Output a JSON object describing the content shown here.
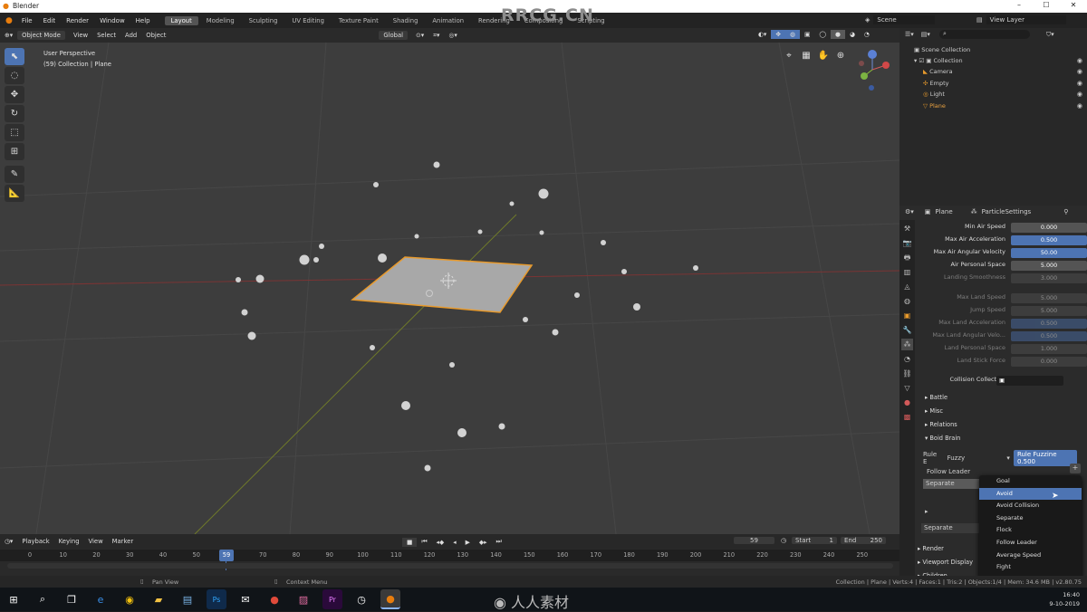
{
  "window": {
    "title": "Blender"
  },
  "menu": [
    "File",
    "Edit",
    "Render",
    "Window",
    "Help"
  ],
  "workspaces": [
    {
      "label": "Layout",
      "active": true
    },
    {
      "label": "Modeling",
      "active": false
    },
    {
      "label": "Sculpting",
      "active": false
    },
    {
      "label": "UV Editing",
      "active": false
    },
    {
      "label": "Texture Paint",
      "active": false
    },
    {
      "label": "Shading",
      "active": false
    },
    {
      "label": "Animation",
      "active": false
    },
    {
      "label": "Rendering",
      "active": false
    },
    {
      "label": "Compositing",
      "active": false
    },
    {
      "label": "Scripting",
      "active": false
    }
  ],
  "scene": {
    "label": "Scene",
    "view_layer": "View Layer"
  },
  "viewport_header": {
    "mode": "Object Mode",
    "menus": [
      "View",
      "Select",
      "Add",
      "Object"
    ],
    "orientation": "Global"
  },
  "viewport_info": {
    "line1": "User Perspective",
    "line2": "(59) Collection | Plane"
  },
  "watermark": "RRCG.CN",
  "outliner": {
    "scene_collection": "Scene Collection",
    "collection": "Collection",
    "items": [
      "Camera",
      "Empty",
      "Light",
      "Plane"
    ]
  },
  "properties": {
    "object": "Plane",
    "settings": "ParticleSettings",
    "rows": [
      {
        "label": "Min Air Speed",
        "value": "0.000",
        "blue": false,
        "dim": false
      },
      {
        "label": "Max Air Acceleration",
        "value": "0.500",
        "blue": true,
        "dim": false
      },
      {
        "label": "Max Air Angular Velocity",
        "value": "50.00",
        "blue": true,
        "dim": false
      },
      {
        "label": "Air Personal Space",
        "value": "5.000",
        "blue": false,
        "dim": false
      },
      {
        "label": "Landing Smoothness",
        "value": "3.000",
        "blue": false,
        "dim": true
      },
      {
        "label": "Max Land Speed",
        "value": "5.000",
        "blue": false,
        "dim": true
      },
      {
        "label": "Jump Speed",
        "value": "5.000",
        "blue": false,
        "dim": true
      },
      {
        "label": "Max Land Acceleration",
        "value": "0.500",
        "blue": true,
        "dim": true
      },
      {
        "label": "Max Land Angular Velo...",
        "value": "0.500",
        "blue": true,
        "dim": true
      },
      {
        "label": "Land Personal Space",
        "value": "1.000",
        "blue": false,
        "dim": true
      },
      {
        "label": "Land Stick Force",
        "value": "0.000",
        "blue": false,
        "dim": true
      }
    ],
    "collision_label": "Collision Collection",
    "panels": [
      "Battle",
      "Misc",
      "Relations",
      "Boid Brain"
    ],
    "rule_label": "Rule E",
    "rule_value": "Fuzzy",
    "rule_fuzziness": "Rule Fuzzine 0.500",
    "follow_leader": "Follow Leader",
    "separate_a": "Separate",
    "separate_b": "Separate",
    "lower_panels": [
      "Render",
      "Viewport Display",
      "Children"
    ]
  },
  "dropdown": {
    "options": [
      "Goal",
      "Avoid",
      "Avoid Collision",
      "Separate",
      "Flock",
      "Follow Leader",
      "Average Speed",
      "Fight"
    ],
    "highlighted": "Avoid"
  },
  "timeline": {
    "menus": [
      "Playback",
      "Keying",
      "View",
      "Marker"
    ],
    "current_frame": "59",
    "start_label": "Start",
    "start": "1",
    "end_label": "End",
    "end": "250",
    "ticks": [
      "0",
      "10",
      "20",
      "30",
      "40",
      "50",
      "70",
      "80",
      "90",
      "100",
      "110",
      "120",
      "130",
      "140",
      "150",
      "160",
      "170",
      "180",
      "190",
      "200",
      "210",
      "220",
      "230",
      "240",
      "250"
    ]
  },
  "statusbar": {
    "left": "Pan View",
    "middle": "Context Menu",
    "right": "Collection | Plane | Verts:4 | Faces:1 | Tris:2 | Objects:1/4 | Mem: 34.6 MB | v2.80.75"
  },
  "taskbar": {
    "watermark": "人人素材",
    "time": "16:40",
    "date": "9-10-2019"
  }
}
